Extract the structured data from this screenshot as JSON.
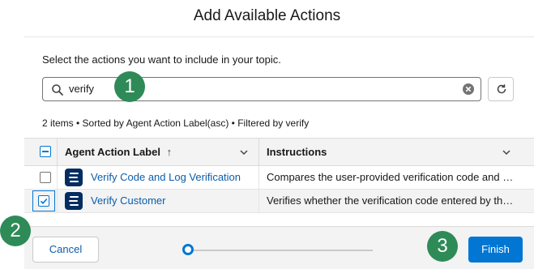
{
  "modal": {
    "title": "Add Available Actions",
    "instruction": "Select the actions you want to include in your topic."
  },
  "search": {
    "value": "verify"
  },
  "list_summary": "2 items • Sorted by Agent Action Label(asc) • Filtered by verify",
  "table": {
    "columns": [
      {
        "label": "Agent Action Label",
        "sort_indicator": "↑"
      },
      {
        "label": "Instructions"
      }
    ],
    "rows": [
      {
        "label": "Verify Code and Log Verification",
        "instructions": "Compares the user-provided verification code and the generated code",
        "checked": false
      },
      {
        "label": "Verify Customer",
        "instructions": "Verifies whether the verification code entered by the customer",
        "checked": true
      }
    ]
  },
  "footer": {
    "cancel_label": "Cancel",
    "finish_label": "Finish",
    "progress_step": 1
  },
  "callouts": [
    "1",
    "2",
    "3"
  ],
  "colors": {
    "brand_blue": "#0176d3",
    "link_blue": "#0b5cab",
    "callout_green": "#2e8b57",
    "agent_icon_navy": "#032d60"
  }
}
